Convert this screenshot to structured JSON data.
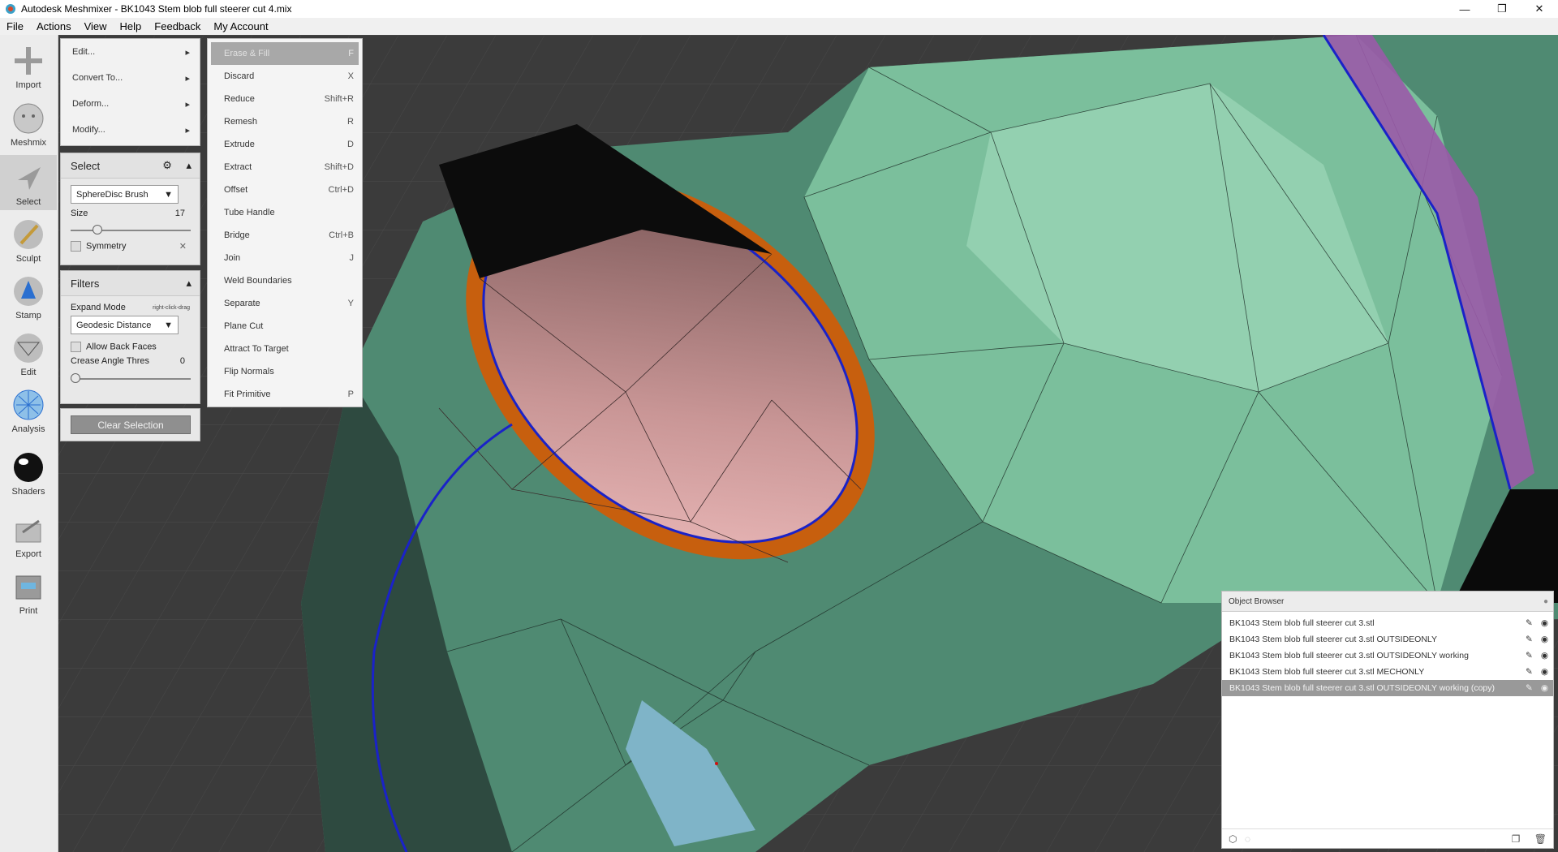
{
  "window": {
    "title": "Autodesk Meshmixer - BK1043 Stem blob full steerer cut 4.mix",
    "controls": [
      "—",
      "❐",
      "✕"
    ]
  },
  "menubar": [
    "File",
    "Actions",
    "View",
    "Help",
    "Feedback",
    "My Account"
  ],
  "toolbar": {
    "items": [
      {
        "label": "Import",
        "icon": "import-icon"
      },
      {
        "label": "Meshmix",
        "icon": "meshmix-icon"
      },
      {
        "label": "Select",
        "icon": "select-arrow-icon"
      },
      {
        "label": "Sculpt",
        "icon": "sculpt-brush-icon"
      },
      {
        "label": "Stamp",
        "icon": "stamp-icon"
      },
      {
        "label": "Edit",
        "icon": "edit-icon"
      },
      {
        "label": "Analysis",
        "icon": "analysis-icon"
      },
      {
        "label": "Shaders",
        "icon": "shaders-icon"
      },
      {
        "label": "Export",
        "icon": "export-icon"
      },
      {
        "label": "Print",
        "icon": "print-icon"
      }
    ],
    "active": "Select"
  },
  "edit_menu": {
    "items": [
      "Edit...",
      "Convert To...",
      "Deform...",
      "Modify..."
    ]
  },
  "edit_submenu": {
    "items": [
      {
        "label": "Erase & Fill",
        "shortcut": "F"
      },
      {
        "label": "Discard",
        "shortcut": "X"
      },
      {
        "label": "Reduce",
        "shortcut": "Shift+R"
      },
      {
        "label": "Remesh",
        "shortcut": "R"
      },
      {
        "label": "Extrude",
        "shortcut": "D"
      },
      {
        "label": "Extract",
        "shortcut": "Shift+D"
      },
      {
        "label": "Offset",
        "shortcut": "Ctrl+D"
      },
      {
        "label": "Tube Handle",
        "shortcut": ""
      },
      {
        "label": "Bridge",
        "shortcut": "Ctrl+B"
      },
      {
        "label": "Join",
        "shortcut": "J"
      },
      {
        "label": "Weld Boundaries",
        "shortcut": ""
      },
      {
        "label": "Separate",
        "shortcut": "Y"
      },
      {
        "label": "Plane Cut",
        "shortcut": ""
      },
      {
        "label": "Attract To Target",
        "shortcut": ""
      },
      {
        "label": "Flip Normals",
        "shortcut": ""
      },
      {
        "label": "Fit Primitive",
        "shortcut": "P"
      }
    ]
  },
  "select_panel": {
    "title": "Select",
    "brush": "SphereDisc Brush",
    "size_label": "Size",
    "size_value": "17",
    "size_fraction": 0.2,
    "symmetry_label": "Symmetry"
  },
  "filters_panel": {
    "title": "Filters",
    "expand_mode_label": "Expand Mode",
    "expand_mode_hint": "right-click-drag",
    "expand_mode": "Geodesic Distance",
    "allow_back_faces_label": "Allow Back Faces",
    "crease_label": "Crease Angle Thres",
    "crease_value": "0",
    "crease_fraction": 0.0
  },
  "clear_selection_label": "Clear Selection",
  "object_browser": {
    "title": "Object Browser",
    "objects": [
      "BK1043 Stem blob full steerer cut 3.stl",
      "BK1043 Stem blob full steerer cut 3.stl OUTSIDEONLY",
      "BK1043 Stem blob full steerer cut 3.stl OUTSIDEONLY working",
      "BK1043 Stem blob full steerer cut 3.stl MECHONLY",
      "BK1043 Stem blob full steerer cut 3.stl OUTSIDEONLY working (copy)"
    ],
    "selected_index": 4
  },
  "colors": {
    "mesh_green": "#5a9a80",
    "mesh_light": "#8ccaa8",
    "boundary_orange": "#c75f0e",
    "boundary_blue": "#1a22c8",
    "inner_pink": "#d8a6a6",
    "background": "#3a3a3a"
  }
}
